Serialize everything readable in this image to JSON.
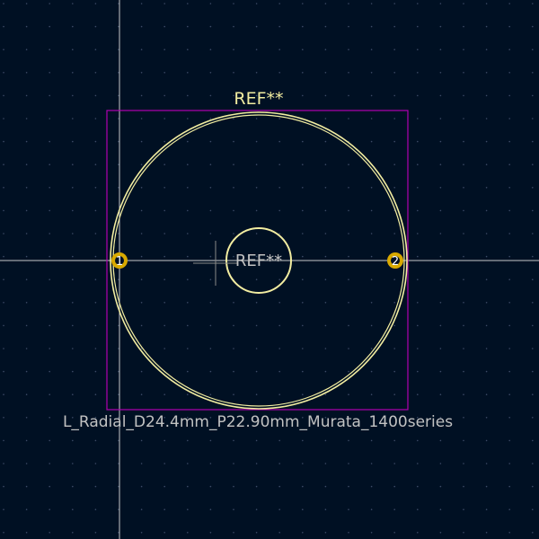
{
  "colors": {
    "background": "#001023",
    "grid_dot": "#3c4a66",
    "crosshair": "#c8c8c8",
    "courtyard": "#b000b0",
    "silkscreen": "#f2eda1",
    "pad": "#d9a900",
    "pad_hole": "#001023",
    "fab_text": "#c2c2c2",
    "ref_top_text": "#f2eda1"
  },
  "footprint": {
    "reference_top": "REF**",
    "reference_center": "REF**",
    "value": "L_Radial_D24.4mm_P22.90mm_Murata_1400series"
  },
  "pads": [
    {
      "number": "1",
      "shape": "circle"
    },
    {
      "number": "2",
      "shape": "circle"
    }
  ],
  "icons": {
    "anchor": "anchor-cross-icon"
  }
}
